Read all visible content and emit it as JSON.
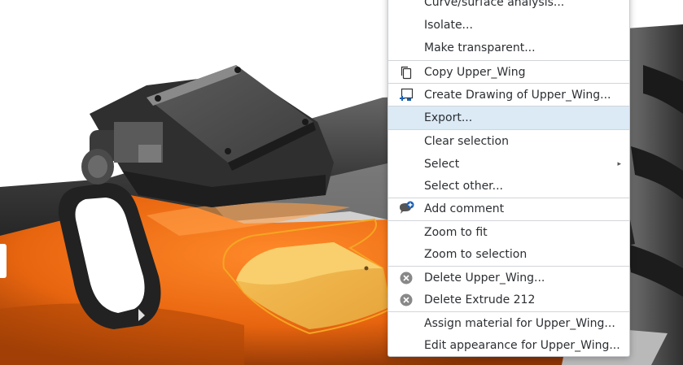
{
  "context_menu": {
    "items": [
      {
        "label": "Curve/surface analysis..."
      },
      {
        "label": "Isolate..."
      },
      {
        "label": "Make transparent..."
      },
      {
        "label": "Copy Upper_Wing",
        "icon": "copy-icon"
      },
      {
        "label": "Create Drawing of Upper_Wing...",
        "icon": "create-drawing-icon"
      },
      {
        "label": "Export...",
        "hovered": true
      },
      {
        "label": "Clear selection"
      },
      {
        "label": "Select",
        "submenu": true,
        "submenu_indicator": "▸"
      },
      {
        "label": "Select other..."
      },
      {
        "label": "Add comment",
        "icon": "add-comment-icon"
      },
      {
        "label": "Zoom to fit"
      },
      {
        "label": "Zoom to selection"
      },
      {
        "label": "Delete Upper_Wing...",
        "icon": "delete-icon"
      },
      {
        "label": "Delete Extrude 212",
        "icon": "delete-icon"
      },
      {
        "label": "Assign material for Upper_Wing..."
      },
      {
        "label": "Edit appearance for Upper_Wing..."
      }
    ]
  },
  "colors": {
    "hover_background": "#dbeaf5",
    "part_orange": "#e8650f",
    "selected_part": "#f3b84a",
    "selection_outline": "#f5a623",
    "accent_blue": "#1b5fb3"
  }
}
